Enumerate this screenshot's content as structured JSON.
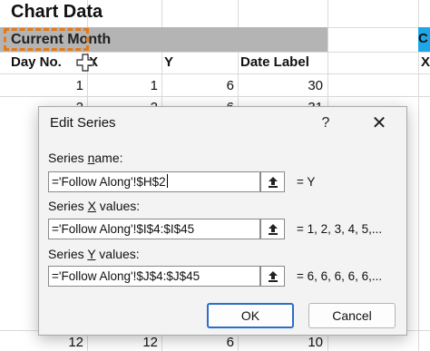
{
  "sheet": {
    "title": "Chart Data",
    "section_label": "Current Month",
    "right_header_partial": "C",
    "columns": [
      "Day No.",
      "X",
      "Y",
      "Date Label"
    ],
    "right_column_partial": "X",
    "row1": [
      "1",
      "1",
      "6",
      "30"
    ],
    "row2_partial": [
      "2",
      "2",
      "6",
      "31"
    ],
    "last_row_partial": [
      "12",
      "12",
      "6",
      "10"
    ]
  },
  "dialog": {
    "title": "Edit Series",
    "help_label": "?",
    "close_label": "✕",
    "series_name": {
      "label_pre": "Series ",
      "label_u": "n",
      "label_post": "ame:",
      "value": "='Follow Along'!$H$2",
      "preview": "= Y"
    },
    "series_x": {
      "label_pre": "Series ",
      "label_u": "X",
      "label_post": " values:",
      "value": "='Follow Along'!$I$4:$I$45",
      "preview": "= 1, 2, 3, 4, 5,..."
    },
    "series_y": {
      "label_pre": "Series ",
      "label_u": "Y",
      "label_post": " values:",
      "value": "='Follow Along'!$J$4:$J$45",
      "preview": "= 6, 6, 6, 6, 6,..."
    },
    "ok_label": "OK",
    "cancel_label": "Cancel"
  },
  "colors": {
    "header_band": "#b4b4b4",
    "selection_dash": "#e07a1c",
    "blue_band": "#1ea6e8",
    "ok_border": "#2a6fc9"
  },
  "icons": [
    "collapse-dialog-icon",
    "cell-select-cursor-icon",
    "close-icon",
    "help-icon"
  ]
}
